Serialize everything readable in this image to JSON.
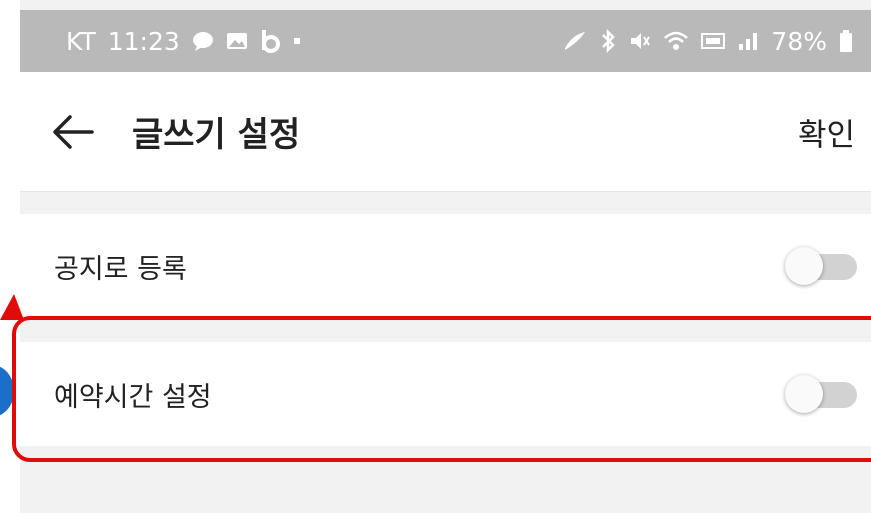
{
  "status_bar": {
    "carrier": "KT",
    "time": "11:23",
    "battery": "78%",
    "left_icons": [
      "chat-bubble-icon",
      "gallery-icon",
      "band-icon",
      "dot-icon"
    ],
    "right_icons": [
      "nfc-icon",
      "bluetooth-icon",
      "mute-icon",
      "wifi-icon",
      "lte-icon",
      "signal-icon",
      "battery-icon"
    ]
  },
  "header": {
    "title": "글쓰기 설정",
    "confirm_label": "확인"
  },
  "settings": [
    {
      "label": "공지로 등록",
      "enabled": false
    },
    {
      "label": "예약시간 설정",
      "enabled": false
    }
  ],
  "annotation": {
    "highlight_color": "#e00b0b",
    "marker_color": "#1b6fc7"
  },
  "colors": {
    "status_bar_bg": "#b9b9b9",
    "screen_bg": "#f2f2f2",
    "toggle_track": "#d2d2d2"
  }
}
